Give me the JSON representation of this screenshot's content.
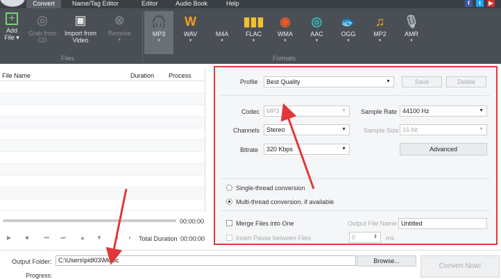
{
  "menu": {
    "items": [
      "Convert",
      "Name/Tag Editor",
      "Editor",
      "Audio Book",
      "Help"
    ],
    "social": [
      "f",
      "t",
      "▶"
    ],
    "social_colors": [
      "#3b5998",
      "#1da1f2",
      "#d62e2e"
    ]
  },
  "ribbon": {
    "add_file": "Add File ▾",
    "grab_cd": "Grab from CD",
    "import_video": "Import from Video",
    "remove": "Remove",
    "files_group": "Files",
    "formats_group": "Formats",
    "formats": [
      {
        "label": "MP3",
        "icon": "headphones-icon",
        "glyph": "🎧",
        "color": "#ffffff",
        "selected": true
      },
      {
        "label": "WAV",
        "icon": "wav-icon",
        "glyph": "W",
        "color": "#f0a020"
      },
      {
        "label": "M4A",
        "icon": "apple-icon",
        "glyph": "",
        "color": "#5aa0e6"
      },
      {
        "label": "FLAC",
        "icon": "equalizer-icon",
        "glyph": "▮▮▮",
        "color": "#f0c030"
      },
      {
        "label": "WMA",
        "icon": "wma-icon",
        "glyph": "◉",
        "color": "#e85a2a"
      },
      {
        "label": "AAC",
        "icon": "aac-icon",
        "glyph": "◎",
        "color": "#30c0c0"
      },
      {
        "label": "OGG",
        "icon": "ogg-icon",
        "glyph": "🐟",
        "color": "#f0d040"
      },
      {
        "label": "MP2",
        "icon": "music-note-icon",
        "glyph": "♫",
        "color": "#f0b020"
      },
      {
        "label": "AMR",
        "icon": "microphone-icon",
        "glyph": "🎙",
        "color": "#b0b8c0"
      }
    ]
  },
  "filelist": {
    "col_name": "File Name",
    "col_duration": "Duration",
    "col_process": "Process"
  },
  "player": {
    "time": "00:00:00",
    "total_label": "Total Duration",
    "total_time": "00:00:00"
  },
  "settings": {
    "profile_label": "Profile",
    "profile_value": "Best Quality",
    "save": "Save",
    "delete": "Delete",
    "codec_label": "Codec",
    "codec_value": "MP3",
    "channels_label": "Channels",
    "channels_value": "Stereo",
    "bitrate_label": "Bitrate",
    "bitrate_value": "320 Kbps",
    "sample_rate_label": "Sample Rate",
    "sample_rate_value": "44100 Hz",
    "sample_size_label": "Sample Size",
    "sample_size_value": "16 bit",
    "advanced": "Advanced",
    "single_thread": "Single-thread conversion",
    "multi_thread": "Multi-thread conversion, if available",
    "merge": "Merge Files into One",
    "output_name_label": "Output File Name",
    "output_name_value": "Untitled",
    "insert_pause": "Insert Pause between Files",
    "pause_value": "0",
    "pause_unit": "ms"
  },
  "bottom": {
    "output_folder_label": "Output Folder:",
    "output_folder_value": "C:\\Users\\pidl03\\Music",
    "browse": "Browse...",
    "progress_label": "Progress:",
    "convert": "Convert Now!"
  },
  "colors": {
    "highlight": "#e03838"
  }
}
